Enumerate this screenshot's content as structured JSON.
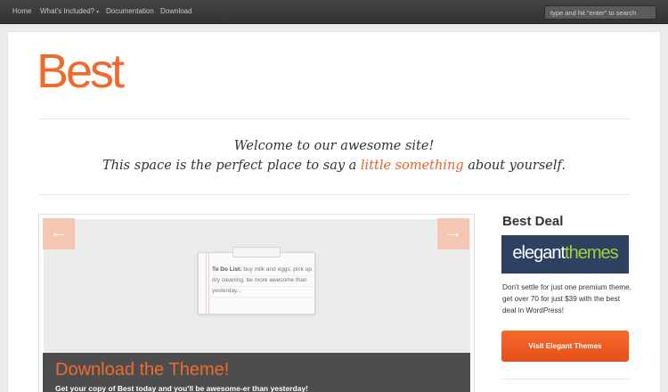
{
  "nav": {
    "items": [
      {
        "label": "Home"
      },
      {
        "label": "What's Included?",
        "has_dropdown": true
      },
      {
        "label": "Documentation"
      },
      {
        "label": "Download"
      }
    ],
    "search_placeholder": "type and hit \"enter\" to search"
  },
  "header": {
    "logo_text": "Best",
    "brand_color": "#f06a2d"
  },
  "welcome": {
    "line1": "Welcome to our awesome site!",
    "line2_before": "This space is the perfect place to say a ",
    "line2_highlight": "little something",
    "line2_after": " about yourself."
  },
  "slider": {
    "prev_icon": "arrow-left-icon",
    "next_icon": "arrow-right-icon",
    "prev_glyph": "←",
    "next_glyph": "→",
    "note_title": "To Do List:",
    "note_body": "buy milk and eggs, pick up dry cleaning, be more awesome than yesterday...",
    "caption_title": "Download the Theme!",
    "caption_sub": "Get your copy of Best today and you'll be awesome-er than yesterday!"
  },
  "sidebar": {
    "title": "Best Deal",
    "banner_part1": "elegant",
    "banner_part2": "themes",
    "text": "Don't settle for just one premium theme, get over 70 for just $39 with the best deal in WordPress!",
    "button_label": "Visit Elegant Themes"
  }
}
